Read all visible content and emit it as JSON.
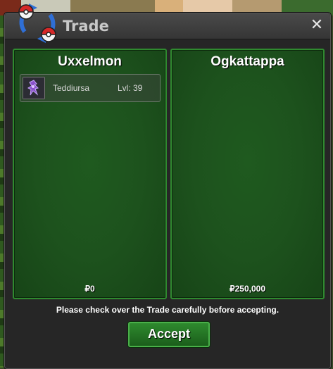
{
  "window": {
    "title": "Trade",
    "close_glyph": "✕",
    "logo_icon": "pokeball-trade-icon"
  },
  "left_panel": {
    "player": "Uxxelmon",
    "pokemon": [
      {
        "name": "Teddiursa",
        "level": "Lvl: 39",
        "icon": "teddiursa-icon"
      }
    ],
    "money": "₽0"
  },
  "right_panel": {
    "player": "Ogkattappa",
    "pokemon": [],
    "money": "₽250,000"
  },
  "footer": {
    "notice": "Please check over the Trade carefully before accepting.",
    "accept_label": "Accept"
  },
  "colors": {
    "panel_green": "#1f5a1f",
    "panel_border": "#2f8a2f",
    "button_green": "#2e8a2e",
    "window_bg": "#262626"
  }
}
